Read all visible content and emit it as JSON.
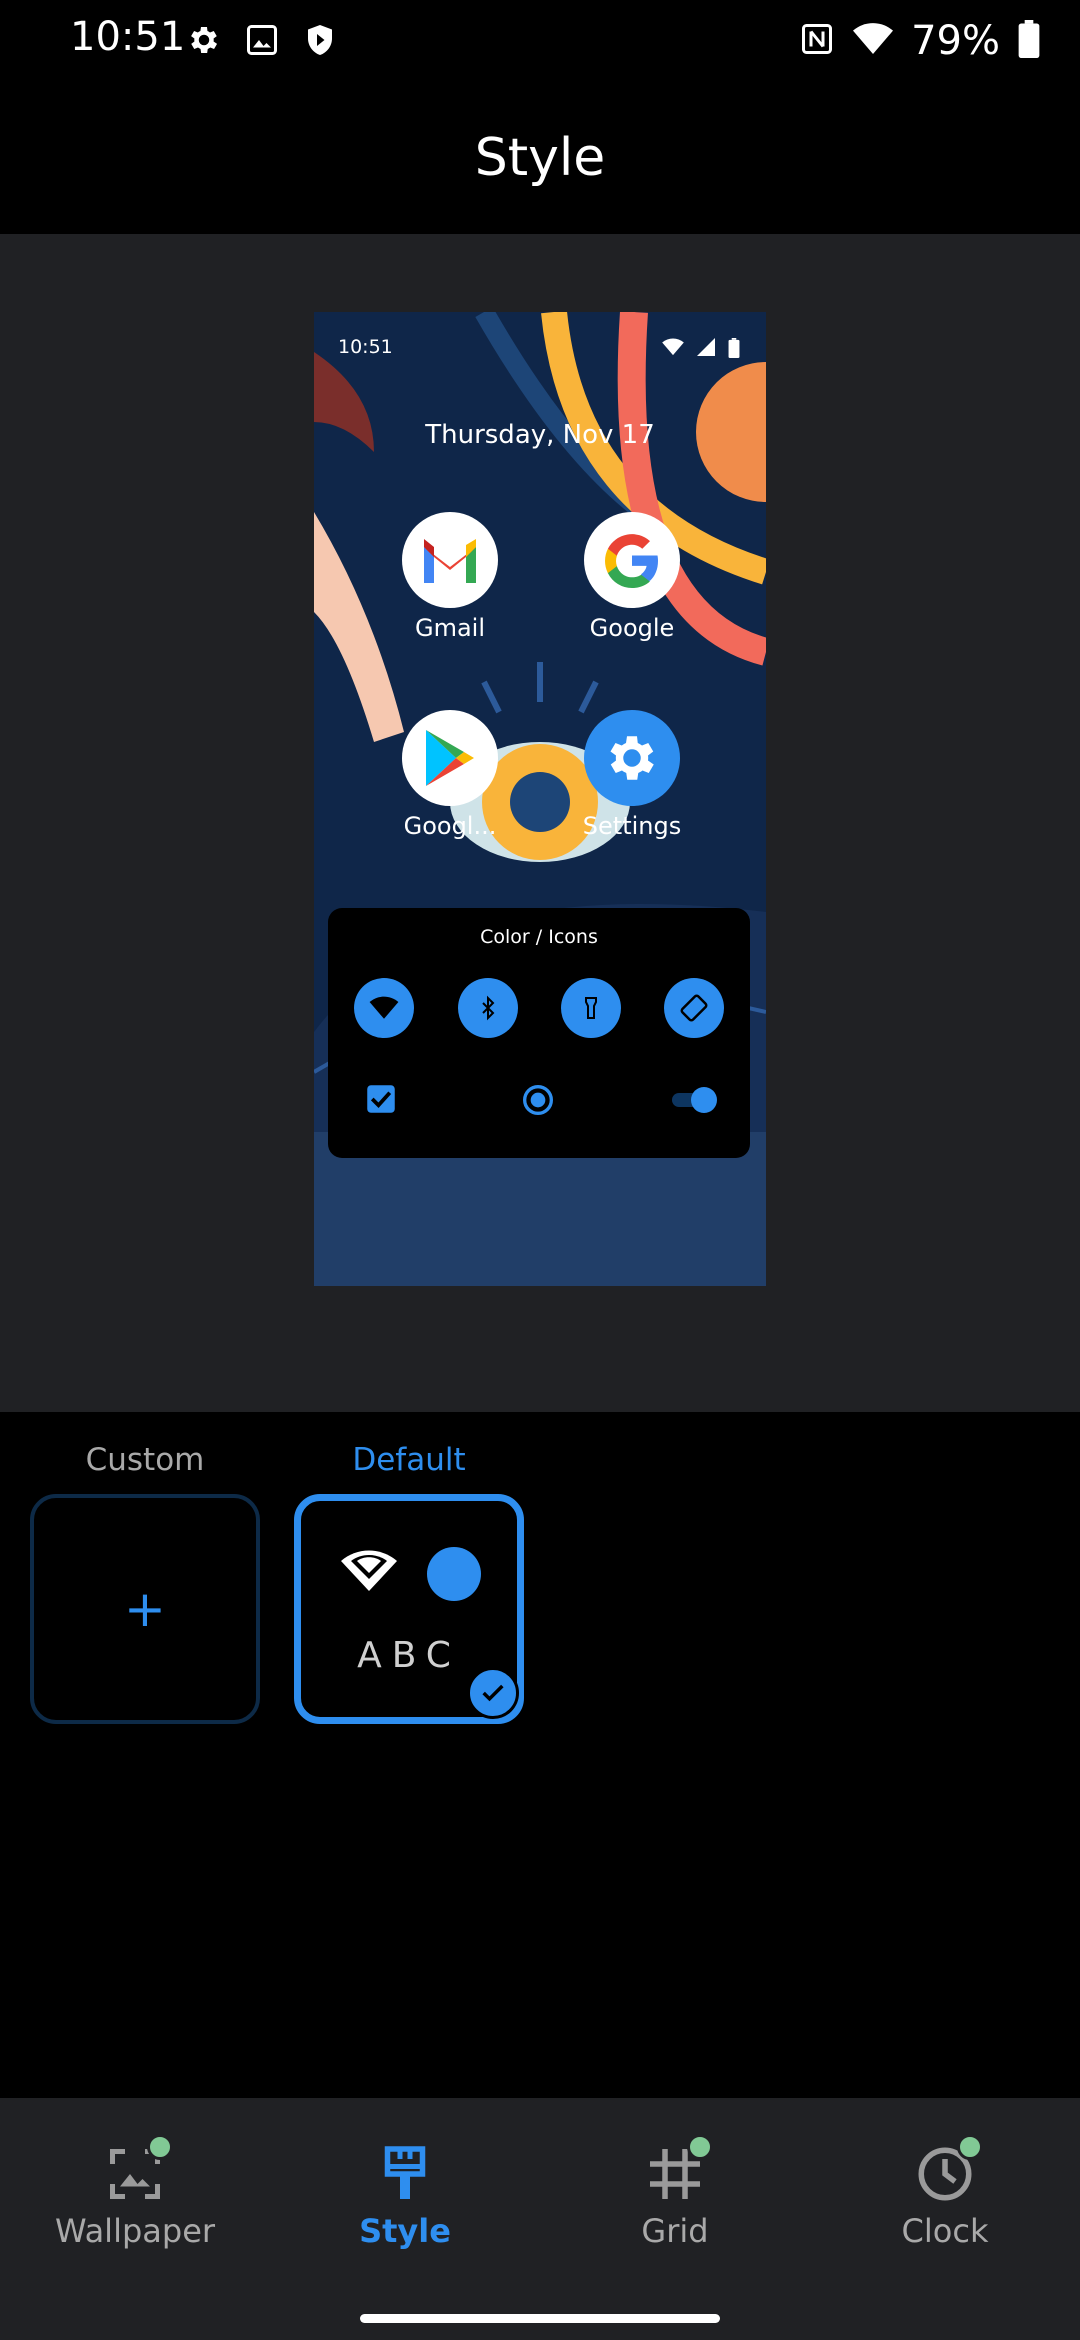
{
  "status_bar": {
    "time": "10:51",
    "battery": "79%",
    "left_icons": [
      "gear-icon",
      "image-icon",
      "shield-icon"
    ],
    "right_icons": [
      "nfc-icon",
      "wifi-icon",
      "battery-icon"
    ]
  },
  "header": {
    "title": "Style"
  },
  "preview": {
    "time": "10:51",
    "date": "Thursday, Nov 17",
    "apps": [
      {
        "label": "Gmail",
        "icon": "gmail-icon"
      },
      {
        "label": "Google",
        "icon": "google-icon"
      },
      {
        "label": "Googl...",
        "icon": "play-store-icon"
      },
      {
        "label": "Settings",
        "icon": "settings-icon"
      }
    ],
    "quick_settings": {
      "title": "Color / Icons",
      "tiles": [
        "wifi-icon",
        "bluetooth-icon",
        "flashlight-icon",
        "rotate-icon"
      ],
      "controls": [
        "checkbox",
        "radio",
        "switch"
      ]
    }
  },
  "options": [
    {
      "label": "Custom",
      "selected": false,
      "content": "+"
    },
    {
      "label": "Default",
      "selected": true,
      "sample_text": "ABC"
    }
  ],
  "nav": [
    {
      "label": "Wallpaper",
      "icon": "wallpaper-icon",
      "active": false,
      "dot": true
    },
    {
      "label": "Style",
      "icon": "style-brush-icon",
      "active": true,
      "dot": false
    },
    {
      "label": "Grid",
      "icon": "grid-icon",
      "active": false,
      "dot": true
    },
    {
      "label": "Clock",
      "icon": "clock-icon",
      "active": false,
      "dot": true
    }
  ],
  "colors": {
    "accent": "#2e8eef",
    "background": "#000000",
    "surface": "#202124",
    "notification_dot": "#81c995"
  }
}
